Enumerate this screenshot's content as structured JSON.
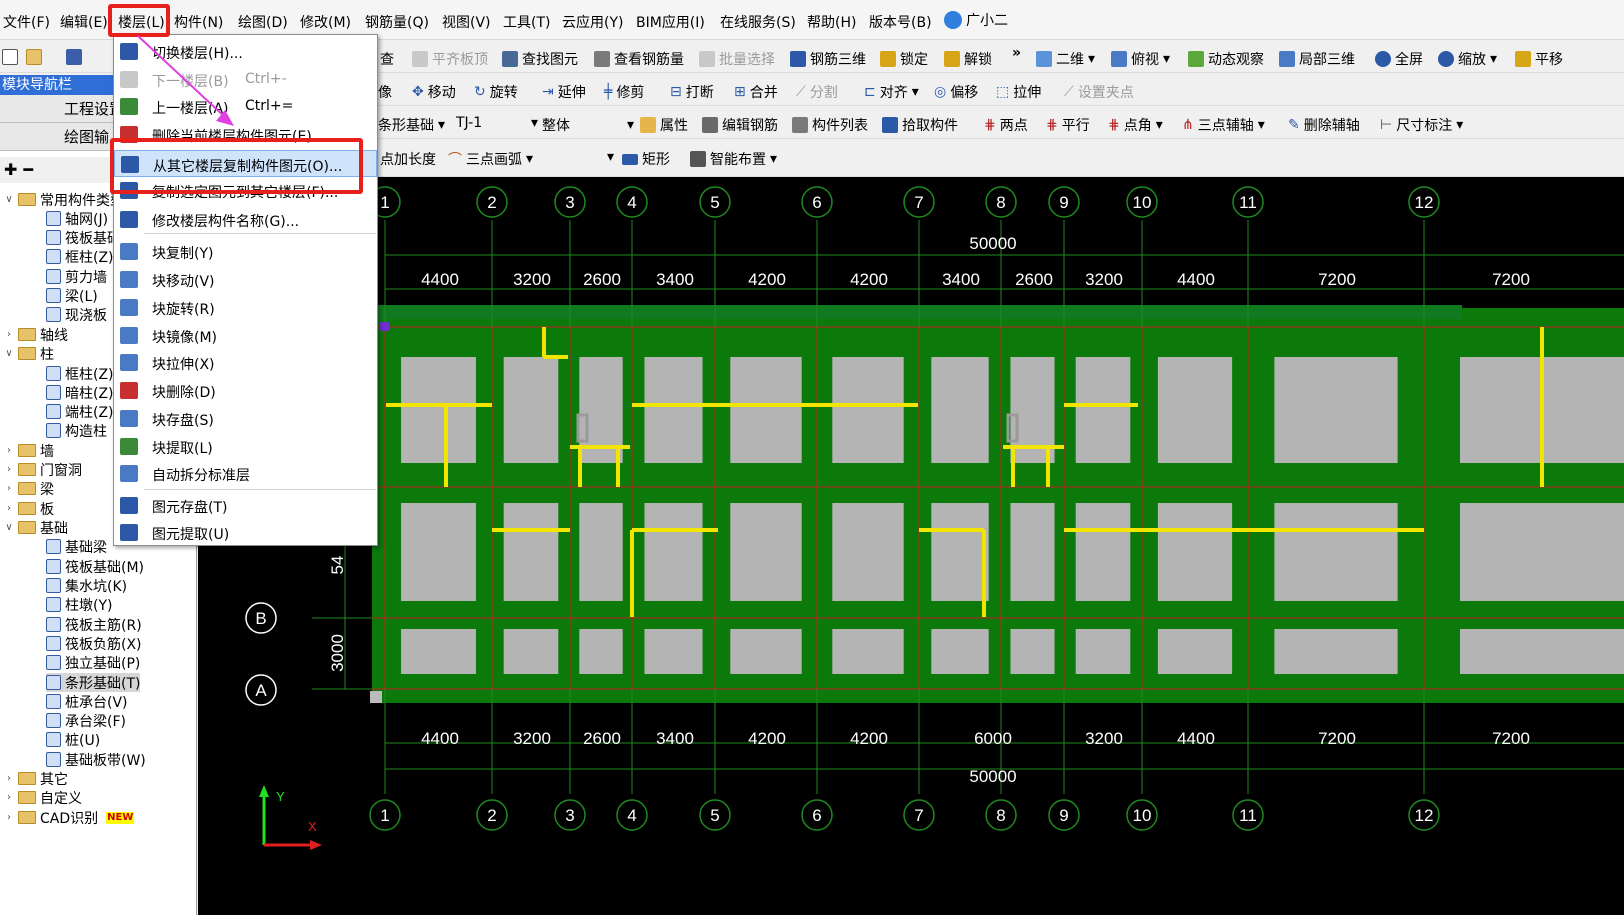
{
  "menubar": {
    "items": [
      "文件(F)",
      "编辑(E)",
      "楼层(L)",
      "构件(N)",
      "绘图(D)",
      "修改(M)",
      "钢筋量(Q)",
      "视图(V)",
      "工具(T)",
      "云应用(Y)",
      "BIM应用(I)",
      "在线服务(S)",
      "帮助(H)",
      "版本号(B)",
      "广小二"
    ]
  },
  "toolbar1": {
    "items": [
      "查",
      "平齐板顶",
      "查找图元",
      "查看钢筋量",
      "批量选择",
      "钢筋三维",
      "锁定",
      "解锁",
      "»",
      "二维",
      "俯视",
      "动态观察",
      "局部三维",
      "全屏",
      "缩放",
      "平移"
    ]
  },
  "toolbar2": {
    "items": [
      "像",
      "移动",
      "旋转",
      "延伸",
      "修剪",
      "打断",
      "合并",
      "分割",
      "对齐",
      "偏移",
      "拉伸",
      "设置夹点"
    ]
  },
  "toolbar3": {
    "items": [
      "条形基础",
      "TJ-1",
      "整体",
      "属性",
      "编辑钢筋",
      "构件列表",
      "拾取构件",
      "两点",
      "平行",
      "点角",
      "三点辅轴",
      "删除辅轴",
      "尺寸标注"
    ]
  },
  "toolbar4": {
    "items": [
      "点加长度",
      "三点画弧",
      "矩形",
      "智能布置"
    ]
  },
  "leftpanel": {
    "header": "模块导航栏",
    "btn1": "工程设置",
    "btn2": "绘图输入",
    "tree": [
      "常用构件类型",
      "轴网(J)",
      "筏板基础",
      "框柱(Z)",
      "剪力墙",
      "梁(L)",
      "现浇板",
      "轴线",
      "柱",
      "框柱(Z)",
      "暗柱(Z)",
      "端柱(Z)",
      "构造柱",
      "墙",
      "门窗洞",
      "梁",
      "板",
      "基础",
      "基础梁",
      "筏板基础(M)",
      "集水坑(K)",
      "柱墩(Y)",
      "筏板主筋(R)",
      "筏板负筋(X)",
      "独立基础(P)",
      "条形基础(T)",
      "桩承台(V)",
      "承台梁(F)",
      "桩(U)",
      "基础板带(W)",
      "其它",
      "自定义",
      "CAD识别"
    ],
    "new_badge": "NEW"
  },
  "dropdown": {
    "items": [
      {
        "label": "切换楼层(H)...",
        "shortcut": ""
      },
      {
        "label": "下一楼层(B)",
        "shortcut": "Ctrl+-"
      },
      {
        "label": "上一楼层(A)",
        "shortcut": "Ctrl+="
      },
      {
        "label": "删除当前楼层构件图元(E)",
        "shortcut": ""
      },
      {
        "label": "从其它楼层复制构件图元(O)...",
        "shortcut": ""
      },
      {
        "label": "复制选定图元到其它楼层(F)...",
        "shortcut": ""
      },
      {
        "label": "修改楼层构件名称(G)...",
        "shortcut": ""
      },
      {
        "label": "块复制(Y)",
        "shortcut": ""
      },
      {
        "label": "块移动(V)",
        "shortcut": ""
      },
      {
        "label": "块旋转(R)",
        "shortcut": ""
      },
      {
        "label": "块镜像(M)",
        "shortcut": ""
      },
      {
        "label": "块拉伸(X)",
        "shortcut": ""
      },
      {
        "label": "块删除(D)",
        "shortcut": ""
      },
      {
        "label": "块存盘(S)",
        "shortcut": ""
      },
      {
        "label": "块提取(L)",
        "shortcut": ""
      },
      {
        "label": "自动拆分标准层",
        "shortcut": ""
      },
      {
        "label": "图元存盘(T)",
        "shortcut": ""
      },
      {
        "label": "图元提取(U)",
        "shortcut": ""
      }
    ]
  },
  "canvas": {
    "axes": [
      "1",
      "2",
      "3",
      "4",
      "5",
      "6",
      "7",
      "8",
      "9",
      "10",
      "11",
      "12"
    ],
    "rows": [
      "B",
      "A"
    ],
    "top_total": "50000",
    "top_dims": [
      "4400",
      "3200",
      "2600",
      "3400",
      "4200",
      "4200",
      "3400",
      "2600",
      "3200",
      "4400",
      "7200",
      "7200"
    ],
    "bottom_total": "50000",
    "bottom_dims": [
      "4400",
      "3200",
      "2600",
      "3400",
      "4200",
      "4200",
      "6000",
      "3200",
      "4400",
      "7200",
      "7200"
    ],
    "left_dims": [
      "54",
      "3000"
    ],
    "ucs_y": "Y",
    "ucs_x": "X"
  },
  "colors": {
    "canvas_bg": "#000000",
    "foundation": "#0b7a0b",
    "pad": "#b4b4b4",
    "beam": "#f2e600",
    "axisline": "#1f8a1f",
    "highlight": "#e8201c",
    "arrow": "#e040e0"
  }
}
